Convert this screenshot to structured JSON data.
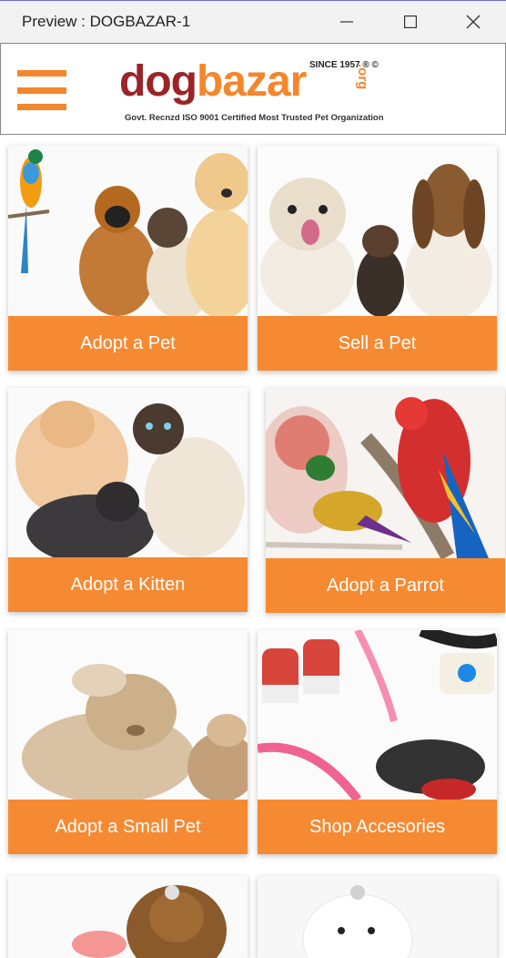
{
  "window": {
    "title": "Preview : DOGBAZAR-1"
  },
  "header": {
    "logo_dog": "dog",
    "logo_bazar": "bazar",
    "logo_org": ".org",
    "since": "SINCE 1957 ® ©",
    "tagline": "Govt. Recnzd ISO 9001 Certified Most Trusted Pet Organization"
  },
  "cards": [
    {
      "label": "Adopt a Pet"
    },
    {
      "label": "Sell a Pet"
    },
    {
      "label": "Adopt a Kitten"
    },
    {
      "label": "Adopt a Parrot"
    },
    {
      "label": "Adopt a Small Pet"
    },
    {
      "label": "Shop Accesories"
    }
  ],
  "colors": {
    "accent": "#f58a33",
    "brand_dark": "#9a2427",
    "menu_icon": "#f4862c"
  }
}
